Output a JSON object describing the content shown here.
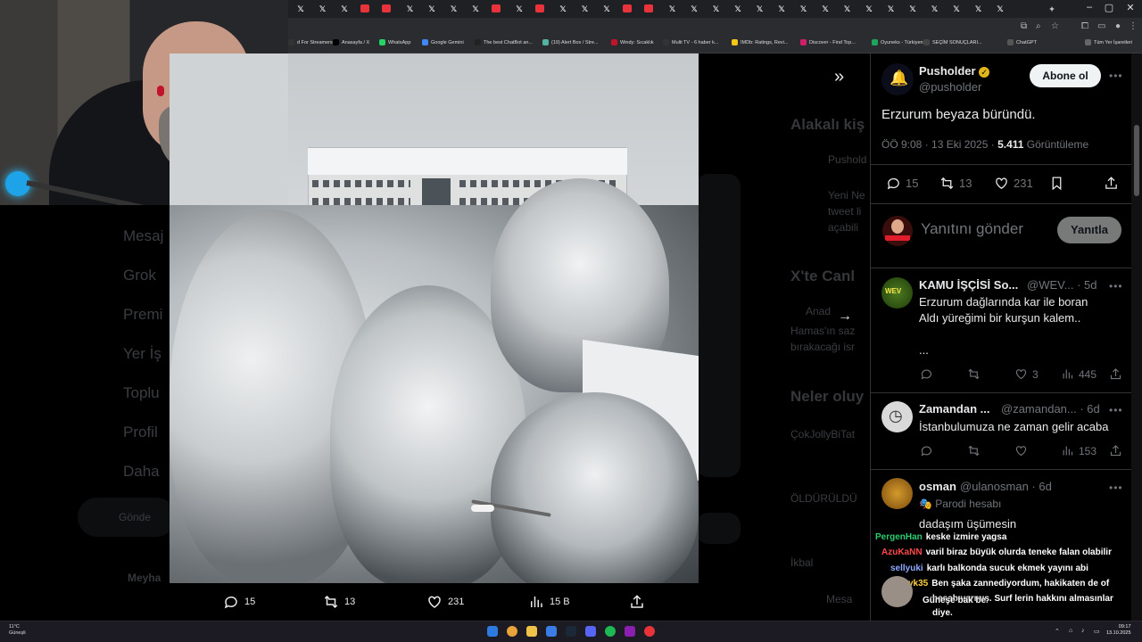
{
  "browser": {
    "bookmarks": [
      "d For Streamers",
      "Anasayfa / X",
      "WhatsApp",
      "Google Gemini",
      "The best ChatBot an...",
      "(19) Alert Box / Stre...",
      "Windy: Sıcaklık",
      "Multi TV - 6 haber k...",
      "IMDb: Ratings, Revi...",
      "Discover - Find Top...",
      "Oyuneks - Türkiyeni...",
      "SEÇİM SONUÇLARI...",
      "ChatGPT",
      "Tüm Yer İşaretleri"
    ],
    "colors": {
      "tab_red": "#e8333a",
      "chrome": "#2b2c30"
    }
  },
  "background_page": {
    "sidebar": [
      "Mesaj",
      "Grok",
      "Premi",
      "Yer İş",
      "Toplu",
      "Profil",
      "Daha"
    ],
    "post_button": "Gönde",
    "sidebar_user": "Meyha",
    "right_headings": [
      "Alakalı kiş",
      "X'te Canl",
      "Neler oluy"
    ],
    "ghost_texts": [
      "Pushold",
      "Yeni Ne",
      "tweet li",
      "açabili",
      "Anad",
      "Hamas'ın saz",
      "bırakacağı isr",
      "ÇokJollyBiTat",
      "ÖLDÜRÜLDÜ",
      "İkbal",
      "Mesa"
    ]
  },
  "media": {
    "actions": {
      "replies": "15",
      "retweets": "13",
      "likes": "231",
      "views": "15 B"
    }
  },
  "tweet": {
    "author": "Pusholder",
    "handle": "@pusholder",
    "follow_label": "Abone ol",
    "text": "Erzurum beyaza büründü.",
    "meta_time": "ÖÖ 9:08 · 13 Eki 2025 · ",
    "views_count": "5.411",
    "views_label": " Görüntüleme",
    "stats": {
      "replies": "15",
      "retweets": "13",
      "likes": "231"
    },
    "reply_placeholder": "Yanıtını gönder",
    "reply_button": "Yanıtla",
    "colors": {
      "verified": "#e2b719"
    }
  },
  "replies": [
    {
      "name": "KAMU İŞÇİSİ So...",
      "handle": "@WEV...",
      "age": " · 5d",
      "lines": [
        "Erzurum dağlarında kar ile boran",
        "Aldı yüreğimi bir kurşun kalem..",
        "",
        "..."
      ],
      "likes": "3",
      "views": "445"
    },
    {
      "name": "Zamandan ...",
      "handle": "@zamandan...",
      "age": " · 6d",
      "lines": [
        "İstanbulumuza ne zaman gelir acaba"
      ],
      "views": "153"
    },
    {
      "name": "osman",
      "handle": "@ulanosman",
      "age": " · 6d",
      "badge": "Parodi hesabı",
      "lines": [
        "dadaşım üşümesin"
      ]
    }
  ],
  "chat": [
    {
      "user": "PergenHan",
      "msg": "keske izmire yagsa",
      "color": "#2ecc71"
    },
    {
      "user": "AzuKaNN",
      "msg": "varil biraz büyük olurda teneke falan olabilir",
      "color": "#ff4b4b"
    },
    {
      "user": "sellyuki",
      "msg": "karlı balkonda sucuk ekmek yayını abi",
      "color": "#8fa8ff"
    },
    {
      "user": "uryk35",
      "msg": "Ben şaka zannediyordum, hakikaten de of",
      "color": "#ffd23f"
    },
    {
      "user": "",
      "msg": "hesabıvarmış. Surf lerin hakkını almasınlar",
      "color": "#ffffff"
    },
    {
      "user": "",
      "msg": "diye.",
      "color": "#ffffff"
    },
    {
      "user": "",
      "msg": "Güneşe bak be",
      "color": "#ffffff"
    },
    {
      "user": "sellyuki",
      "msg": "",
      "color": "#8fa8ff"
    }
  ],
  "taskbar": {
    "weather_temp": "11°C",
    "weather_desc": "Güneşli",
    "time": "09:17",
    "date": "13.10.2025"
  }
}
